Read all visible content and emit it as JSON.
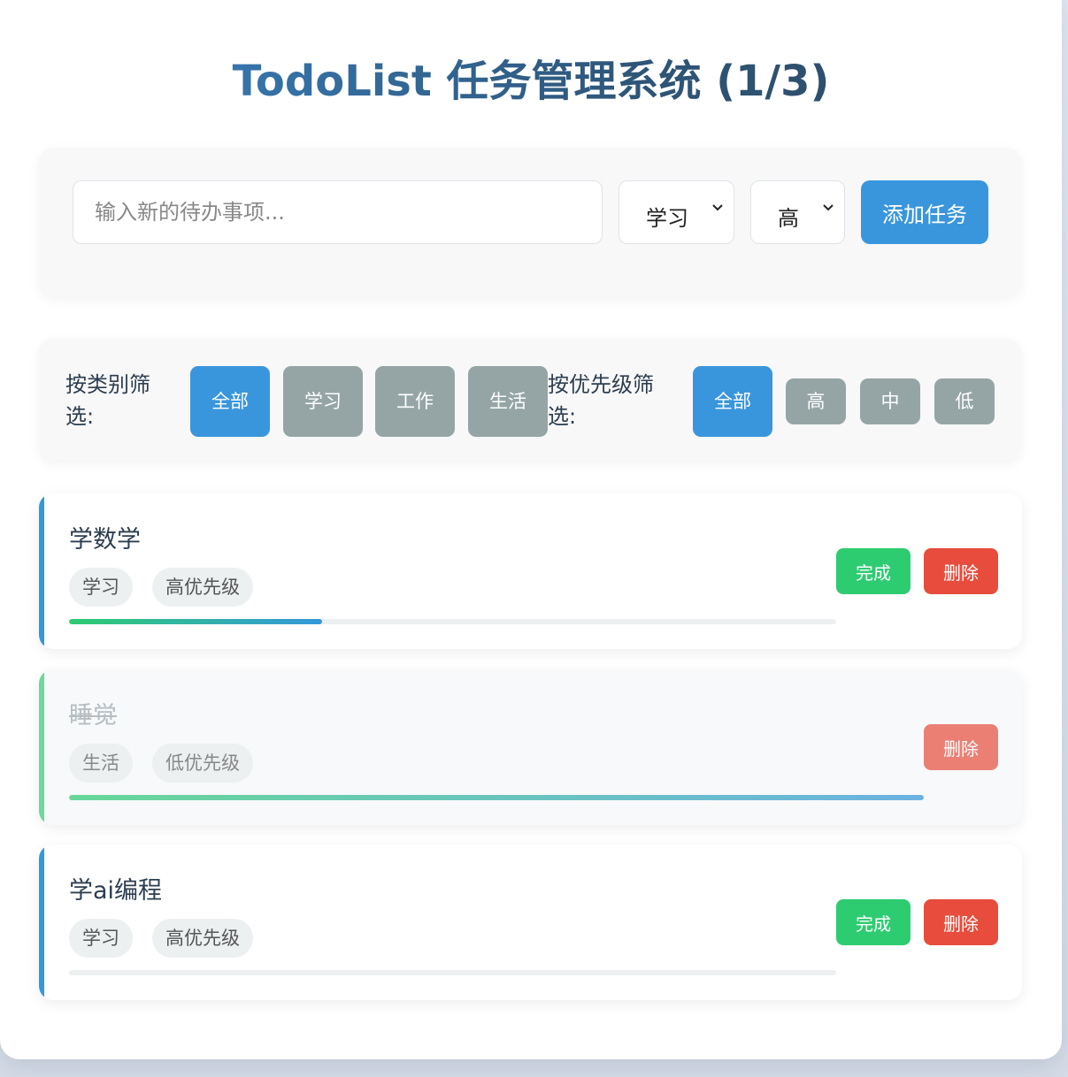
{
  "header": {
    "title": "TodoList 任务管理系统 (1/3)"
  },
  "add_form": {
    "input_placeholder": "输入新的待办事项...",
    "input_value": "",
    "category_selected": "学习",
    "priority_selected": "高",
    "add_label": "添加任务"
  },
  "filters": {
    "category_label": "按类别筛选:",
    "category_options": [
      "全部",
      "学习",
      "工作",
      "生活"
    ],
    "category_active": "全部",
    "priority_label": "按优先级筛选:",
    "priority_options": [
      "全部",
      "高",
      "中",
      "低"
    ],
    "priority_active": "全部"
  },
  "tasks": [
    {
      "title": "学数学",
      "category": "学习",
      "priority": "高优先级",
      "progress": 0.33,
      "completed": false,
      "complete_label": "完成",
      "delete_label": "删除",
      "accent": "#3498db"
    },
    {
      "title": "睡觉",
      "category": "生活",
      "priority": "低优先级",
      "progress": 1.0,
      "completed": true,
      "delete_label": "删除",
      "accent": "#6fd89b"
    },
    {
      "title": "学ai编程",
      "category": "学习",
      "priority": "高优先级",
      "progress": 0.0,
      "completed": false,
      "complete_label": "完成",
      "delete_label": "删除",
      "accent": "#3498db"
    }
  ],
  "colors": {
    "primary": "#3a96dc",
    "inactive": "#95a5a6",
    "success": "#2ecc71",
    "danger": "#e74c3c"
  }
}
